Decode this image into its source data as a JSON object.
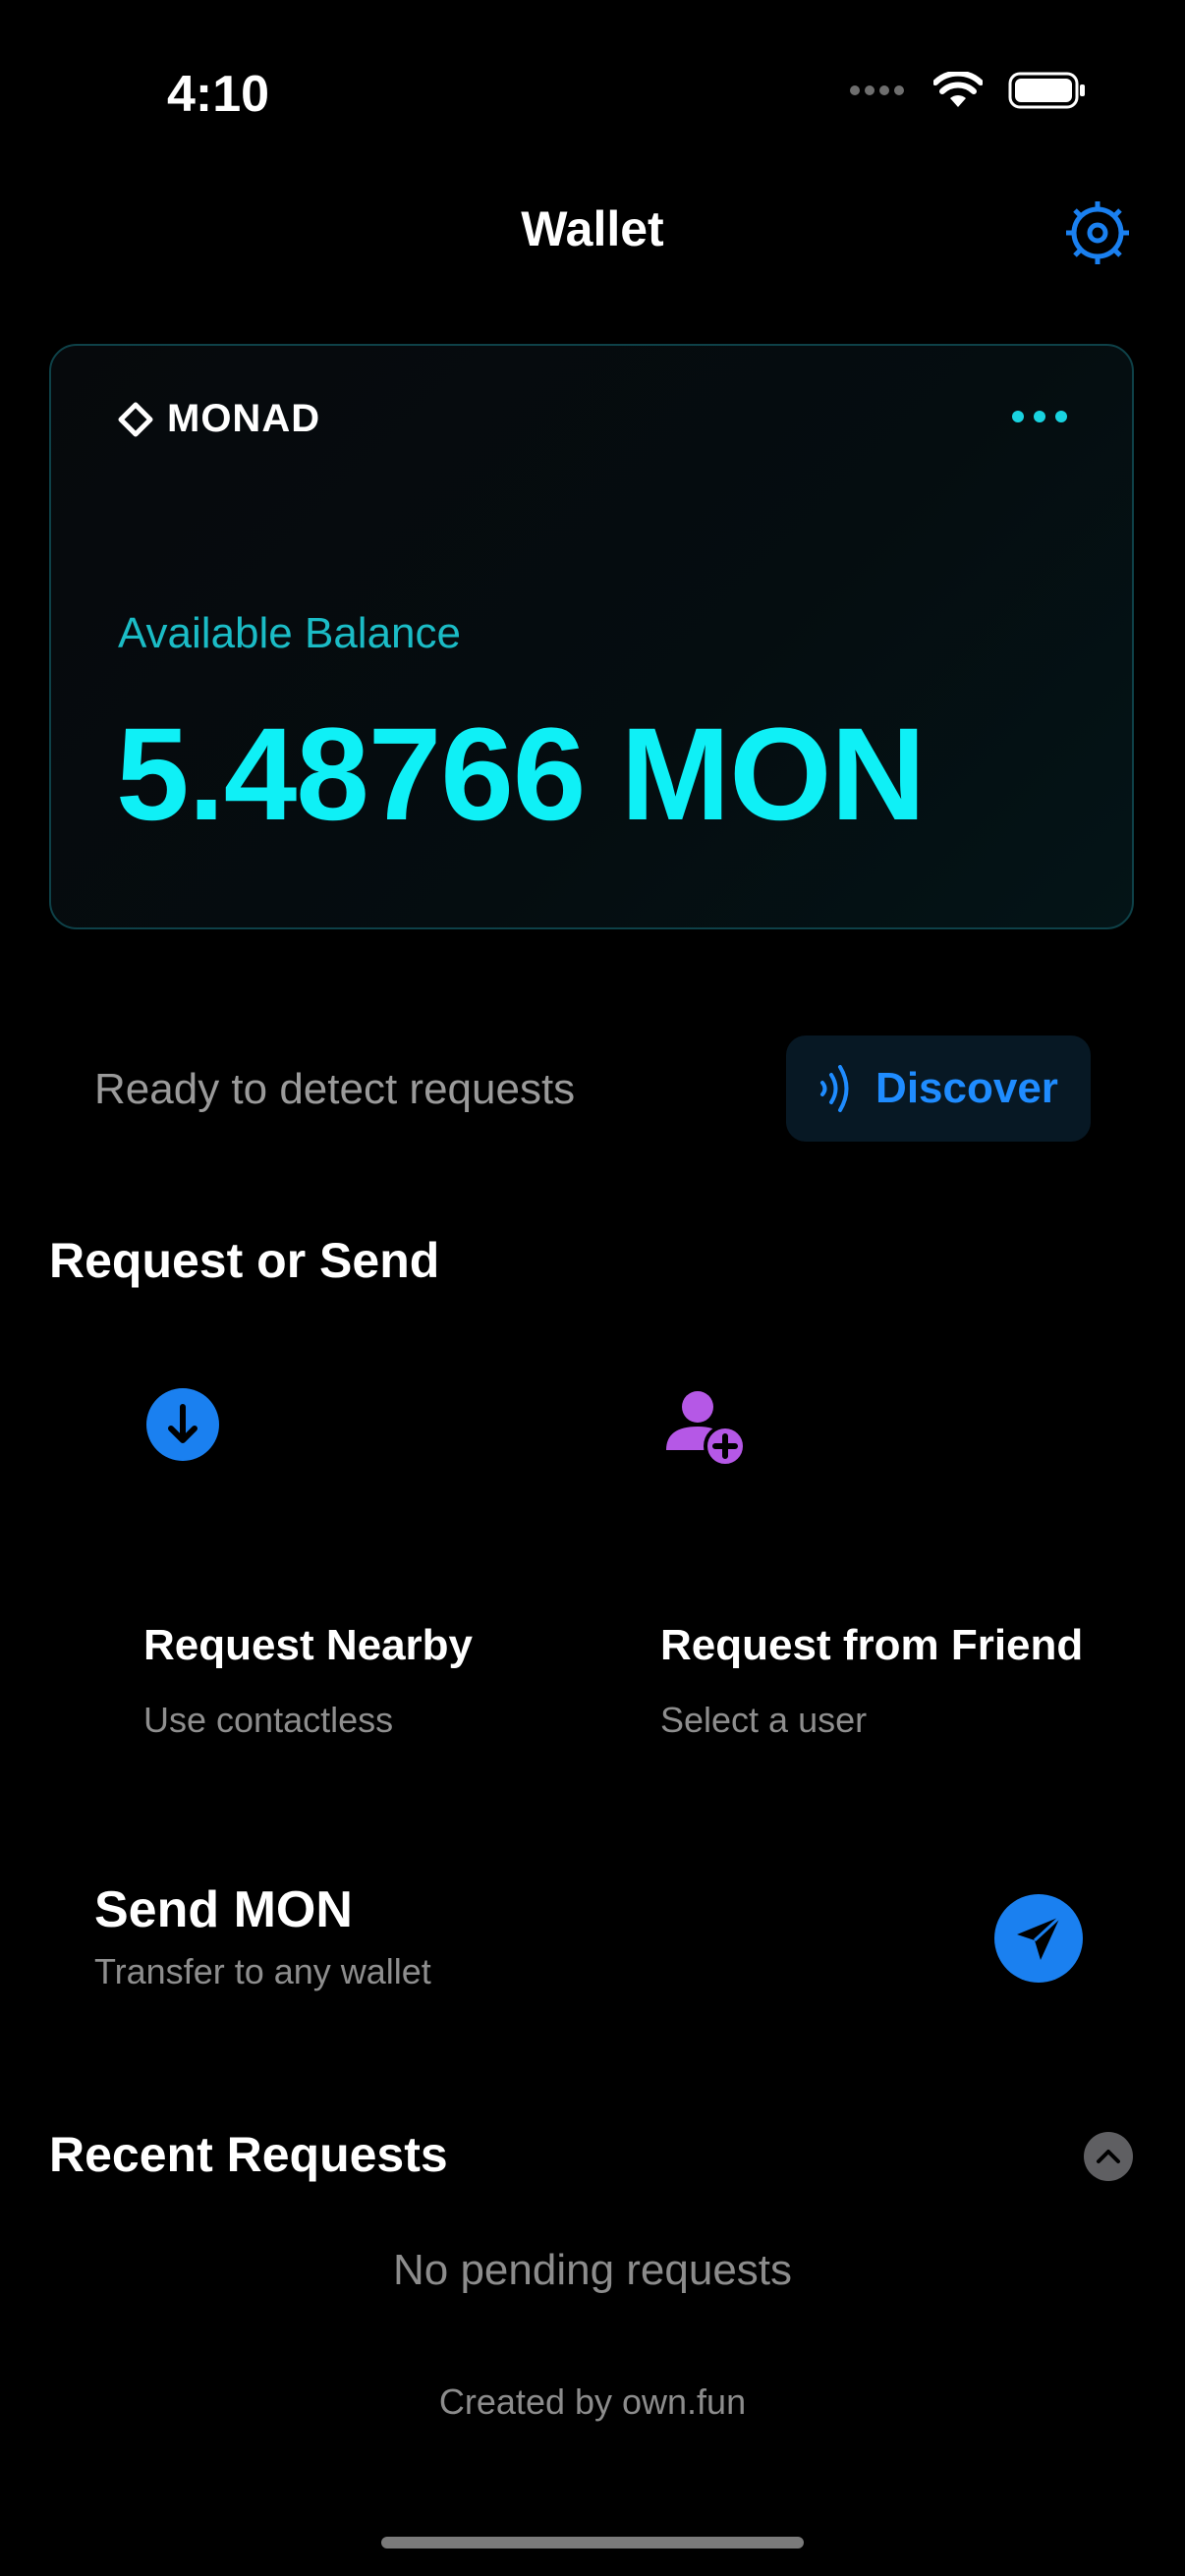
{
  "status_bar": {
    "time": "4:10"
  },
  "header": {
    "title": "Wallet"
  },
  "balance_card": {
    "brand": "MONAD",
    "label": "Available Balance",
    "value": "5.48766 MON",
    "accent_color": "#0ff0f6"
  },
  "detect": {
    "status_text": "Ready to detect requests",
    "button_label": "Discover"
  },
  "request_or_send": {
    "title": "Request or Send",
    "tiles": [
      {
        "title": "Request Nearby",
        "subtitle": "Use contactless",
        "icon": "arrow-down-circle-icon"
      },
      {
        "title": "Request from Friend",
        "subtitle": "Select a user",
        "icon": "person-add-icon"
      }
    ],
    "send": {
      "title": "Send MON",
      "subtitle": "Transfer to any wallet",
      "icon": "paper-plane-icon"
    }
  },
  "recent": {
    "title": "Recent Requests",
    "empty_text": "No pending requests"
  },
  "footer": {
    "credit": "Created by own.fun"
  },
  "colors": {
    "blue": "#1a80f0",
    "purple": "#b558e6",
    "cyan": "#0ff0f6"
  }
}
